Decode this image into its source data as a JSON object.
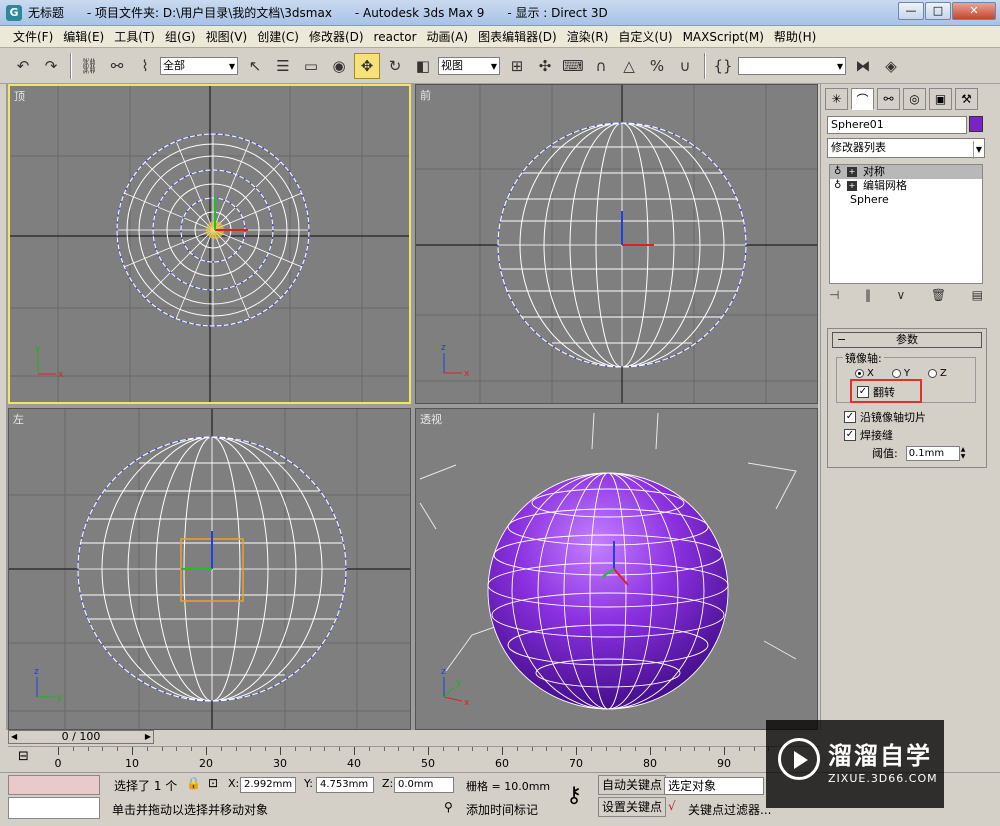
{
  "window": {
    "title": "无标题      - 项目文件夹: D:\\用户目录\\我的文档\\3dsmax      - Autodesk 3ds Max 9      - 显示 : Direct 3D",
    "app_icon": "3ds-max-icon",
    "min": "—",
    "max": "□",
    "close": "✕"
  },
  "menu": [
    "文件(F)",
    "编辑(E)",
    "工具(T)",
    "组(G)",
    "视图(V)",
    "创建(C)",
    "修改器(D)",
    "reactor",
    "动画(A)",
    "图表编辑器(D)",
    "渲染(R)",
    "自定义(U)",
    "MAXScript(M)",
    "帮助(H)"
  ],
  "toolbar": {
    "selection_filter": "全部",
    "ref_coord": "视图",
    "named_sel": ""
  },
  "viewports": {
    "top": "顶",
    "front": "前",
    "left": "左",
    "perspective": "透视"
  },
  "panel": {
    "object_name": "Sphere01",
    "modifier_list": "修改器列表",
    "stack": [
      {
        "label": "对称",
        "selected": true
      },
      {
        "label": "编辑网格",
        "selected": false
      }
    ],
    "base_object": "Sphere",
    "rollout_title": "参数",
    "mirror_axis_label": "镜像轴:",
    "axes": [
      "X",
      "Y",
      "Z"
    ],
    "flip_label": "翻转",
    "slice_label": "沿镜像轴切片",
    "weld_label": "焊接缝",
    "threshold_label": "阈值:",
    "threshold_value": "0.1mm",
    "colors": {
      "object": "#7a23c9",
      "highlight": "#d9352c"
    }
  },
  "timeline": {
    "frame_display": "0 / 100",
    "ticks": [
      "0",
      "10",
      "20",
      "30",
      "40",
      "50",
      "60",
      "70",
      "80",
      "90"
    ]
  },
  "status": {
    "selected": "选择了 1 个",
    "x_label": "X:",
    "x_value": "2.992mm",
    "y_label": "Y:",
    "y_value": "4.753mm",
    "z_label": "Z:",
    "z_value": "0.0mm",
    "grid": "栅格 = 10.0mm",
    "prompt": "单击并拖动以选择并移动对象",
    "add_time_tag": "添加时间标记",
    "auto_key": "自动关键点",
    "set_key": "设置关键点",
    "selection_set": "选定对象",
    "key_filters": "关键点过滤器..."
  },
  "watermark": {
    "title": "溜溜自学",
    "url": "ZIXUE.3D66.COM"
  }
}
